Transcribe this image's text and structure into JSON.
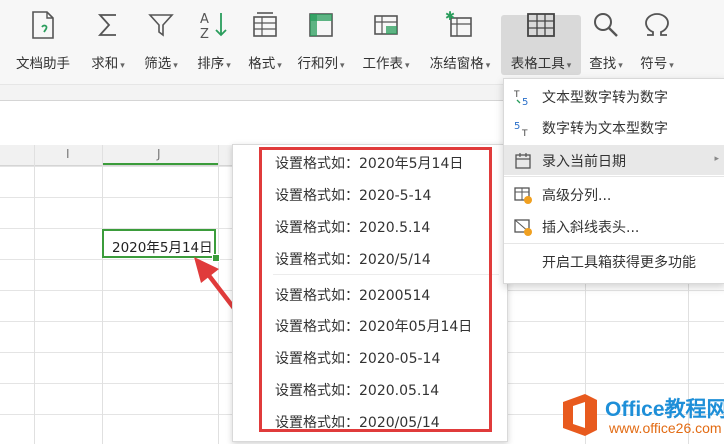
{
  "toolbar": {
    "buttons": [
      {
        "label": "文档助手",
        "icon": "document-assistant-icon",
        "arrow": ""
      },
      {
        "label": "求和",
        "icon": "sum-icon",
        "arrow": "▾"
      },
      {
        "label": "筛选",
        "icon": "filter-icon",
        "arrow": "▾"
      },
      {
        "label": "排序",
        "icon": "sort-icon",
        "arrow": "▾"
      },
      {
        "label": "格式",
        "icon": "format-icon",
        "arrow": "▾"
      },
      {
        "label": "行和列",
        "icon": "rows-columns-icon",
        "arrow": "▾"
      },
      {
        "label": "工作表",
        "icon": "worksheet-icon",
        "arrow": "▾"
      },
      {
        "label": "冻结窗格",
        "icon": "freeze-panes-icon",
        "arrow": "▾"
      },
      {
        "label": "表格工具",
        "icon": "table-tools-icon",
        "arrow": "▾"
      },
      {
        "label": "查找",
        "icon": "search-icon",
        "arrow": "▾"
      },
      {
        "label": "符号",
        "icon": "omega-symbol-icon",
        "arrow": "▾"
      }
    ]
  },
  "columns": {
    "col_i": "I",
    "col_j": "J"
  },
  "cell": {
    "value": "2020年5月14日"
  },
  "date_format_list": [
    "设置格式如：2020年5月14日",
    "设置格式如：2020-5-14",
    "设置格式如：2020.5.14",
    "设置格式如：2020/5/14",
    "设置格式如：20200514",
    "设置格式如：2020年05月14日",
    "设置格式如：2020-05-14",
    "设置格式如：2020.05.14",
    "设置格式如：2020/05/14"
  ],
  "table_tools_menu": [
    {
      "label": "文本型数字转为数字",
      "icon": "text-to-number-icon"
    },
    {
      "label": "数字转为文本型数字",
      "icon": "number-to-text-icon"
    },
    {
      "label": "录入当前日期",
      "icon": "calendar-icon",
      "submenu": "▸"
    },
    {
      "label": "高级分列...",
      "icon": "advanced-split-icon"
    },
    {
      "label": "插入斜线表头...",
      "icon": "diagonal-header-icon"
    },
    {
      "label": "开启工具箱获得更多功能",
      "icon": ""
    }
  ],
  "watermark": {
    "brand": "Office教程网",
    "url": "www.office26.com"
  },
  "colors": {
    "accent_green": "#3b9c3b",
    "highlight_red": "#e03b3b",
    "brand_blue": "#1e8fd8",
    "brand_orange": "#e26b13"
  }
}
